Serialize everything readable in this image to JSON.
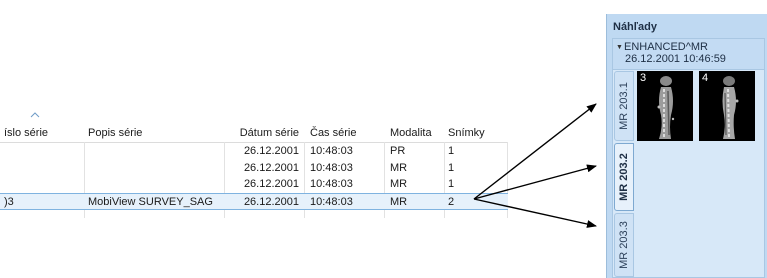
{
  "series_table": {
    "columns": [
      "íslo série",
      "Popis série",
      "Dátum série",
      "Čas série",
      "Modalita",
      "Snímky"
    ],
    "rows": [
      {
        "number": "",
        "description": "",
        "date": "26.12.2001",
        "time": "10:48:03",
        "modality": "PR",
        "images": "1"
      },
      {
        "number": "",
        "description": "",
        "date": "26.12.2001",
        "time": "10:48:03",
        "modality": "MR",
        "images": "1"
      },
      {
        "number": "",
        "description": "",
        "date": "26.12.2001",
        "time": "10:48:03",
        "modality": "MR",
        "images": "1"
      },
      {
        "number": ")3",
        "description": "MobiView SURVEY_SAG",
        "date": "26.12.2001",
        "time": "10:48:03",
        "modality": "MR",
        "images": "2"
      }
    ],
    "selected_row": 3
  },
  "previews": {
    "title": "Náhľady",
    "group": {
      "name": "ENHANCED^MR",
      "datetime": "26.12.2001 10:46:59"
    },
    "tabs": [
      {
        "label": "MR 203.1",
        "active": false
      },
      {
        "label": "MR 203.2",
        "active": true
      },
      {
        "label": "MR 203.3",
        "active": false
      }
    ],
    "thumbnails": [
      {
        "number": "3"
      },
      {
        "number": "4"
      }
    ]
  },
  "colors": {
    "panel_bg": "#bfd9f2",
    "selected_row": "#e6f1fb",
    "arrow": "#000000"
  }
}
